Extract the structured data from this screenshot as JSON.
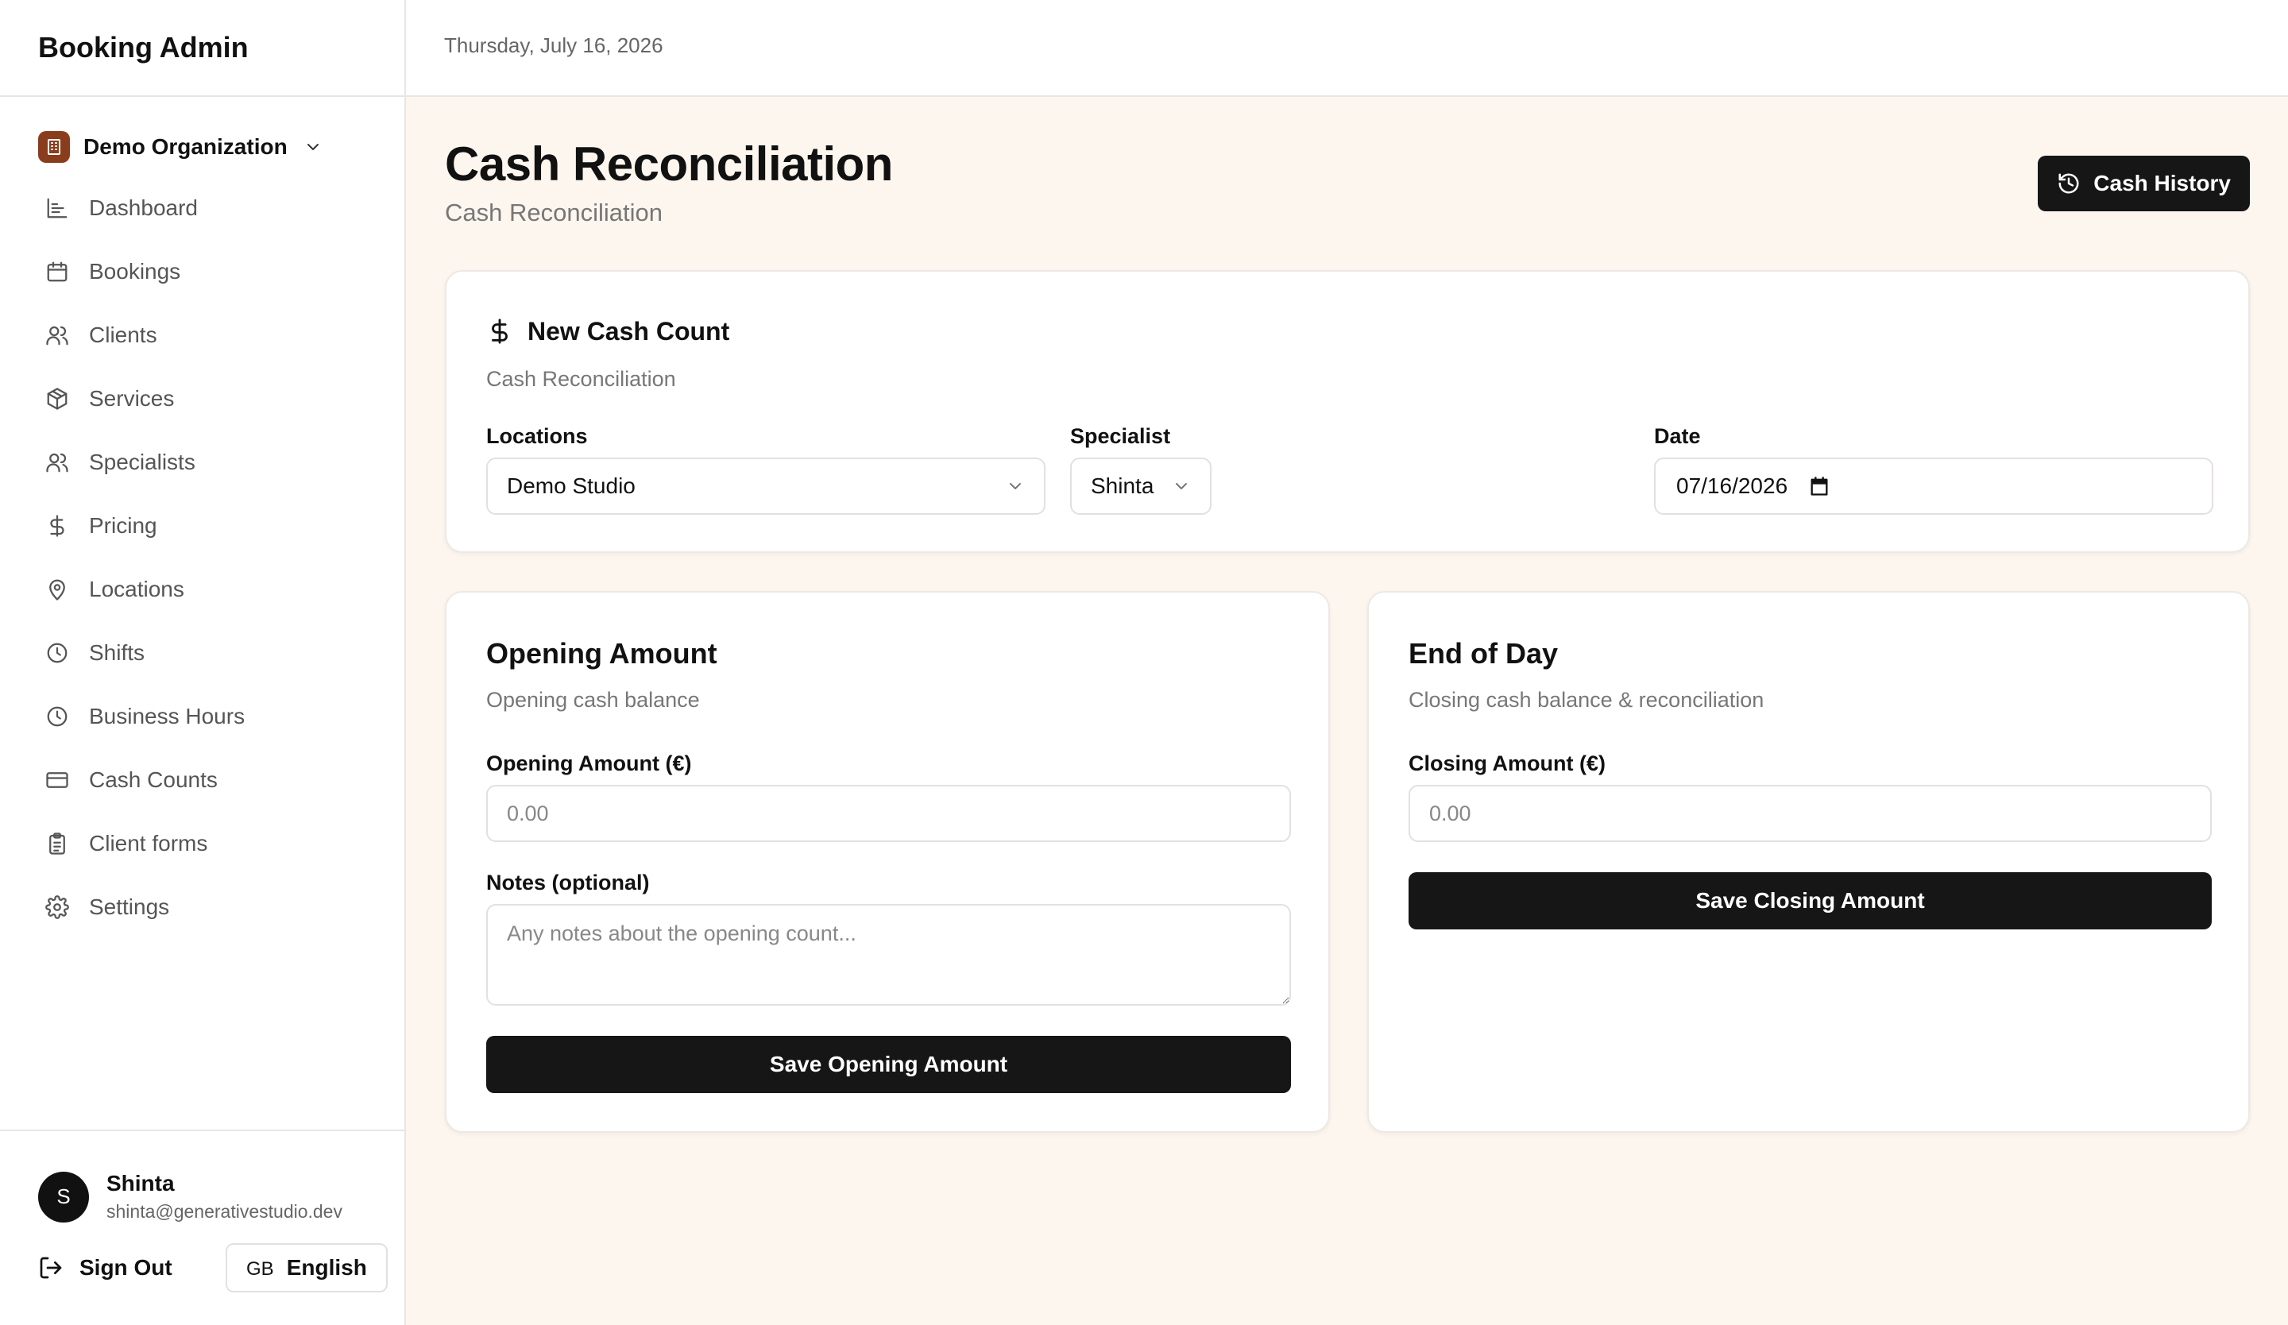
{
  "app": {
    "title": "Booking Admin"
  },
  "org": {
    "name": "Demo Organization"
  },
  "nav": [
    {
      "label": "Dashboard",
      "icon": "chart-icon"
    },
    {
      "label": "Bookings",
      "icon": "calendar-icon"
    },
    {
      "label": "Clients",
      "icon": "users-icon"
    },
    {
      "label": "Services",
      "icon": "package-icon"
    },
    {
      "label": "Specialists",
      "icon": "users-icon"
    },
    {
      "label": "Pricing",
      "icon": "dollar-icon"
    },
    {
      "label": "Locations",
      "icon": "map-pin-icon"
    },
    {
      "label": "Shifts",
      "icon": "clock-icon"
    },
    {
      "label": "Business Hours",
      "icon": "clock-icon"
    },
    {
      "label": "Cash Counts",
      "icon": "credit-card-icon"
    },
    {
      "label": "Client forms",
      "icon": "clipboard-icon"
    },
    {
      "label": "Settings",
      "icon": "gear-icon"
    }
  ],
  "user": {
    "initial": "S",
    "name": "Shinta",
    "email": "shinta@generativestudio.dev"
  },
  "footer": {
    "signout_label": "Sign Out",
    "lang_code": "GB",
    "lang_label": "English"
  },
  "topbar": {
    "date": "Thursday, July 16, 2026"
  },
  "page": {
    "title": "Cash Reconciliation",
    "subtitle": "Cash Reconciliation",
    "history_label": "Cash History"
  },
  "new_count": {
    "title": "New Cash Count",
    "desc": "Cash Reconciliation",
    "locations_label": "Locations",
    "location_value": "Demo Studio",
    "specialist_label": "Specialist",
    "specialist_value": "Shinta",
    "date_label": "Date",
    "date_value": "07/16/2026"
  },
  "opening": {
    "title": "Opening Amount",
    "desc": "Opening cash balance",
    "amount_label": "Opening Amount (€)",
    "amount_placeholder": "0.00",
    "notes_label": "Notes (optional)",
    "notes_placeholder": "Any notes about the opening count...",
    "save_label": "Save Opening Amount"
  },
  "eod": {
    "title": "End of Day",
    "desc": "Closing cash balance & reconciliation",
    "amount_label": "Closing Amount (€)",
    "amount_placeholder": "0.00",
    "save_label": "Save Closing Amount"
  }
}
